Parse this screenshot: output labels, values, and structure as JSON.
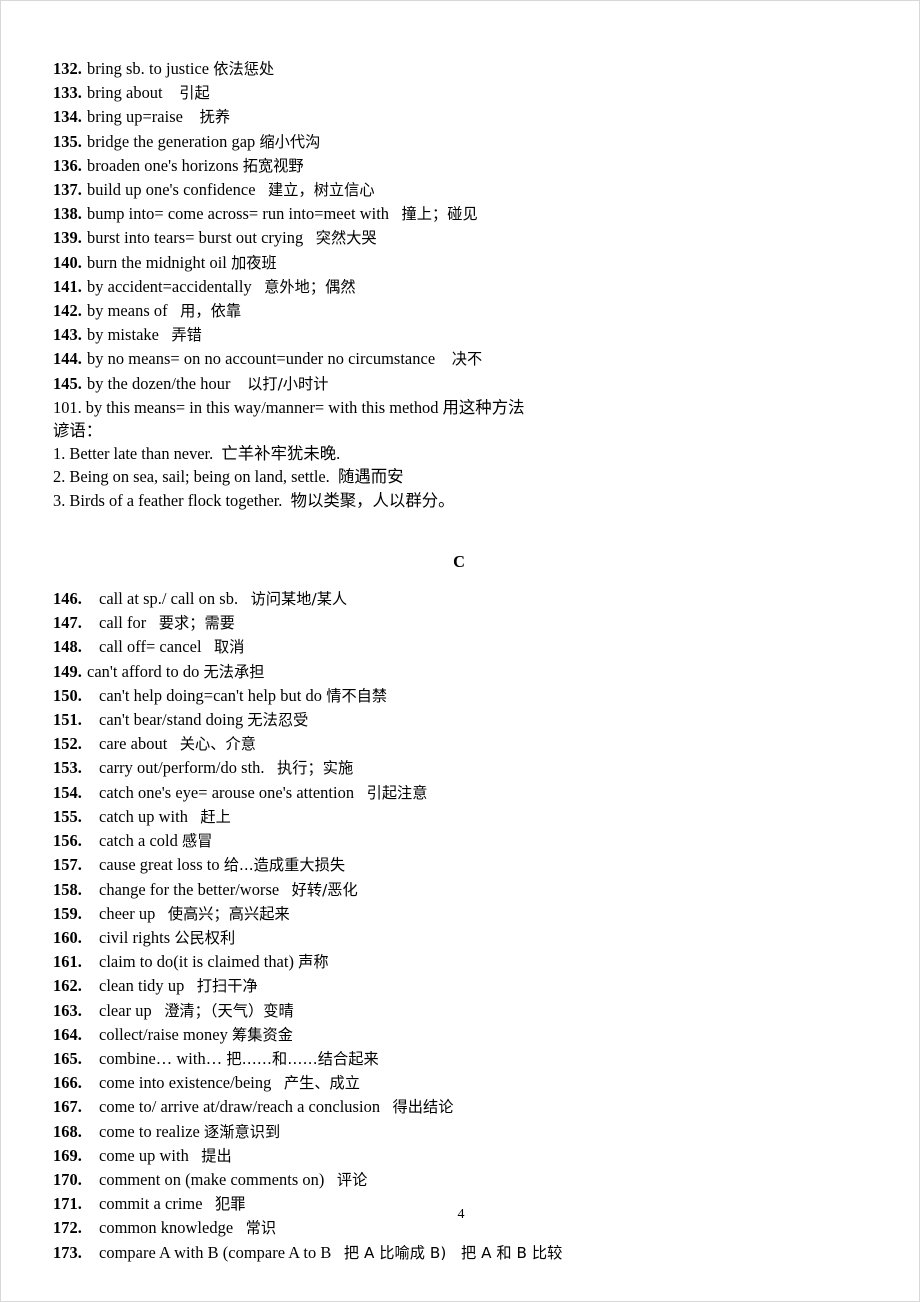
{
  "document": {
    "page_number": "4",
    "sections": [
      {
        "id": "section-b-continued",
        "letter": null,
        "entries": [
          {
            "num": "132.",
            "en": "bring sb. to justice",
            "cn": "依法惩处",
            "gap": " ",
            "style": "tight"
          },
          {
            "num": "133.",
            "en": "bring about",
            "cn": "引起",
            "gap": "    ",
            "style": "tight"
          },
          {
            "num": "134.",
            "en": "bring up=raise",
            "cn": "抚养",
            "gap": "    ",
            "style": "tight"
          },
          {
            "num": "135.",
            "en": "bridge the generation gap",
            "cn": "缩小代沟",
            "gap": " ",
            "style": "tight"
          },
          {
            "num": "136.",
            "en": "broaden one's horizons",
            "cn": "拓宽视野",
            "gap": " ",
            "style": "tight"
          },
          {
            "num": "137.",
            "en": "build up one's confidence",
            "cn": "建立，树立信心",
            "gap": "   ",
            "style": "tight"
          },
          {
            "num": "138.",
            "en": "bump into= come across= run into=meet with",
            "cn": "撞上；碰见",
            "gap": "   ",
            "style": "tight"
          },
          {
            "num": "139.",
            "en": "burst into tears= burst out crying",
            "cn": "突然大哭",
            "gap": "   ",
            "style": "tight"
          },
          {
            "num": "140.",
            "en": "burn the midnight oil",
            "cn": "加夜班",
            "gap": " ",
            "style": "tight"
          },
          {
            "num": "141.",
            "en": "by accident=accidentally",
            "cn": "意外地；偶然",
            "gap": "   ",
            "style": "tight"
          },
          {
            "num": "142.",
            "en": "by means of",
            "cn": "用，依靠",
            "gap": "   ",
            "style": "tight"
          },
          {
            "num": "143.",
            "en": "by mistake",
            "cn": "弄错",
            "gap": "   ",
            "style": "tight"
          },
          {
            "num": "144.",
            "en": "by no means= on no account=under no circumstance",
            "cn": "决不",
            "gap": "    ",
            "style": "tight"
          },
          {
            "num": "145.",
            "en": "by the dozen/the hour",
            "cn": "以打/小时计",
            "gap": "    ",
            "style": "tight"
          }
        ]
      }
    ],
    "unnumbered_lines": [
      {
        "id": "line-101",
        "text": "101. by this means= in this way/manner= with this method 用这种方法"
      },
      {
        "id": "line-proverbs-heading",
        "text": "谚语："
      },
      {
        "id": "proverb-1",
        "text": "1. Better late than never.  亡羊补牢犹未晚."
      },
      {
        "id": "proverb-2",
        "text": "2. Being on sea, sail; being on land, settle.  随遇而安"
      },
      {
        "id": "proverb-3",
        "text": "3. Birds of a feather flock together.  物以类聚，人以群分。"
      }
    ],
    "section_c": {
      "letter": "C",
      "entries": [
        {
          "num": "146.",
          "en": "call at sp./ call on sb.",
          "cn": "访问某地/某人",
          "gap": "   ",
          "style": "pad"
        },
        {
          "num": "147.",
          "en": "call for",
          "cn": "要求；需要",
          "gap": "   ",
          "style": "pad"
        },
        {
          "num": "148.",
          "en": "call off= cancel",
          "cn": "取消",
          "gap": "   ",
          "style": "pad"
        },
        {
          "num": "149.",
          "en": "can't afford to do",
          "cn": "无法承担",
          "gap": " ",
          "style": "tight"
        },
        {
          "num": "150.",
          "en": "can't help doing=can't help but do",
          "cn": "情不自禁",
          "gap": " ",
          "style": "pad"
        },
        {
          "num": "151.",
          "en": "can't bear/stand doing",
          "cn": "无法忍受",
          "gap": " ",
          "style": "pad"
        },
        {
          "num": "152.",
          "en": "care about",
          "cn": "关心、介意",
          "gap": "   ",
          "style": "pad"
        },
        {
          "num": "153.",
          "en": "carry out/perform/do sth.",
          "cn": "执行；实施",
          "gap": "   ",
          "style": "pad"
        },
        {
          "num": "154.",
          "en": "catch one's eye= arouse one's attention",
          "cn": "引起注意",
          "gap": "   ",
          "style": "pad"
        },
        {
          "num": "155.",
          "en": "catch up with",
          "cn": "赶上",
          "gap": "   ",
          "style": "pad"
        },
        {
          "num": "156.",
          "en": "catch a cold",
          "cn": "感冒",
          "gap": " ",
          "style": "pad"
        },
        {
          "num": "157.",
          "en": "cause great loss to",
          "cn": "给...造成重大损失",
          "gap": " ",
          "style": "pad"
        },
        {
          "num": "158.",
          "en": "change for the better/worse",
          "cn": "好转/恶化",
          "gap": "   ",
          "style": "pad"
        },
        {
          "num": "159.",
          "en": "cheer up",
          "cn": "使高兴；高兴起来",
          "gap": "   ",
          "style": "pad"
        },
        {
          "num": "160.",
          "en": "civil rights",
          "cn": "公民权利",
          "gap": " ",
          "style": "pad"
        },
        {
          "num": "161.",
          "en": "claim to do(it is claimed that)",
          "cn": "声称",
          "gap": " ",
          "style": "pad"
        },
        {
          "num": "162.",
          "en": "clean tidy up",
          "cn": "打扫干净",
          "gap": "   ",
          "style": "pad"
        },
        {
          "num": "163.",
          "en": "clear up",
          "cn": "澄清；（天气）变晴",
          "gap": "   ",
          "style": "pad"
        },
        {
          "num": "164.",
          "en": "collect/raise money",
          "cn": "筹集资金",
          "gap": " ",
          "style": "pad"
        },
        {
          "num": "165.",
          "en": "combine… with…",
          "cn": "把……和……结合起来",
          "gap": " ",
          "style": "pad"
        },
        {
          "num": "166.",
          "en": "come into existence/being",
          "cn": "产生、成立",
          "gap": "   ",
          "style": "pad"
        },
        {
          "num": "167.",
          "en": "come to/ arrive at/draw/reach a conclusion",
          "cn": "得出结论",
          "gap": "   ",
          "style": "pad"
        },
        {
          "num": "168.",
          "en": "come to realize",
          "cn": "逐渐意识到",
          "gap": " ",
          "style": "pad"
        },
        {
          "num": "169.",
          "en": "come up with",
          "cn": "提出",
          "gap": "   ",
          "style": "pad"
        },
        {
          "num": "170.",
          "en": "comment on (make comments on)",
          "cn": "评论",
          "gap": "   ",
          "style": "pad"
        },
        {
          "num": "171.",
          "en": "commit a crime",
          "cn": "犯罪",
          "gap": "   ",
          "style": "pad"
        },
        {
          "num": "172.",
          "en": "common knowledge",
          "cn": "常识",
          "gap": "   ",
          "style": "pad"
        },
        {
          "num": "173.",
          "en": "compare A with B (compare A to B",
          "cn": "把 A 比喻成 B)   把 A 和 B 比较",
          "gap": "   ",
          "style": "pad"
        }
      ]
    }
  }
}
